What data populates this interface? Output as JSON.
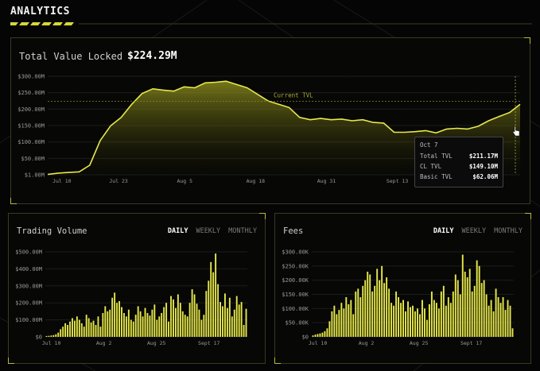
{
  "header": {
    "title": "ANALYTICS"
  },
  "colors": {
    "accent": "#e6e84a",
    "accent_dim": "#8a8b25",
    "panel_border": "#3a3a22",
    "bg": "#050505"
  },
  "icons": {
    "cursor": "hand-pointer-icon"
  },
  "tvl": {
    "label": "Total Value Locked",
    "value": "$224.29M",
    "reference_label": "Current TVL",
    "tooltip": {
      "date": "Oct 7",
      "rows": [
        {
          "label": "Total TVL",
          "value": "$211.17M"
        },
        {
          "label": "CL TVL",
          "value": "$149.10M"
        },
        {
          "label": "Basic TVL",
          "value": "$62.06M"
        }
      ]
    }
  },
  "volume": {
    "title": "Trading Volume",
    "tabs": [
      "DAILY",
      "WEEKLY",
      "MONTHLY"
    ],
    "active_tab": "DAILY"
  },
  "fees": {
    "title": "Fees",
    "tabs": [
      "DAILY",
      "WEEKLY",
      "MONTHLY"
    ],
    "active_tab": "DAILY"
  },
  "chart_data": [
    {
      "type": "area",
      "y_ticks": [
        "$300.00M",
        "$250.00M",
        "$200.00M",
        "$150.00M",
        "$100.00M",
        "$50.00M",
        "$1.00M"
      ],
      "ylim": [
        1,
        300
      ],
      "x_ticks": [
        "Jul 10",
        "Jul 23",
        "Aug 5",
        "Aug 18",
        "Aug 31",
        "Sept 13"
      ],
      "reference_value": 224.29,
      "x": [
        0,
        2,
        4,
        6,
        8,
        10,
        12,
        14,
        16,
        18,
        20,
        22,
        24,
        26,
        28,
        30,
        32,
        34,
        36,
        38,
        40,
        42,
        44,
        46,
        48,
        50,
        52,
        54,
        56,
        58,
        60,
        62,
        64,
        66,
        68,
        70,
        72,
        74,
        76,
        78,
        80,
        82,
        84,
        86,
        88,
        90
      ],
      "values": [
        2,
        6,
        8,
        10,
        30,
        105,
        150,
        175,
        215,
        248,
        262,
        258,
        255,
        268,
        265,
        280,
        282,
        285,
        275,
        265,
        245,
        225,
        215,
        205,
        175,
        168,
        172,
        168,
        170,
        165,
        168,
        160,
        158,
        130,
        130,
        132,
        135,
        128,
        140,
        142,
        140,
        148,
        165,
        178,
        190,
        215
      ],
      "grid": true
    },
    {
      "type": "bar",
      "y_ticks": [
        "$500.00M",
        "$400.00M",
        "$300.00M",
        "$200.00M",
        "$100.00M",
        "$0"
      ],
      "ylim": [
        0,
        500
      ],
      "x_ticks": [
        "Jul 10",
        "Aug 2",
        "Aug 25",
        "Sept 17"
      ],
      "values": [
        5,
        6,
        8,
        10,
        15,
        25,
        45,
        60,
        80,
        70,
        90,
        110,
        95,
        120,
        100,
        80,
        60,
        130,
        110,
        85,
        95,
        70,
        120,
        60,
        140,
        180,
        150,
        160,
        230,
        260,
        200,
        210,
        175,
        140,
        120,
        160,
        100,
        90,
        130,
        180,
        150,
        120,
        170,
        140,
        125,
        160,
        190,
        100,
        120,
        140,
        175,
        200,
        90,
        240,
        220,
        170,
        250,
        200,
        150,
        130,
        120,
        200,
        280,
        250,
        195,
        160,
        100,
        130,
        270,
        330,
        440,
        380,
        490,
        310,
        205,
        180,
        255,
        170,
        230,
        120,
        160,
        240,
        190,
        205,
        70,
        165
      ],
      "grid": true
    },
    {
      "type": "bar",
      "y_ticks": [
        "$300.00K",
        "$250.00K",
        "$200.00K",
        "$150.00K",
        "$100.00K",
        "$50.00K",
        "$0"
      ],
      "ylim": [
        0,
        300
      ],
      "x_ticks": [
        "Jul 10",
        "Aug 2",
        "Aug 25",
        "Sept 17"
      ],
      "values": [
        5,
        8,
        10,
        12,
        15,
        20,
        30,
        55,
        90,
        110,
        80,
        95,
        120,
        100,
        140,
        115,
        130,
        80,
        160,
        170,
        140,
        180,
        200,
        230,
        220,
        160,
        180,
        240,
        200,
        250,
        190,
        210,
        170,
        120,
        110,
        160,
        140,
        120,
        130,
        90,
        125,
        105,
        110,
        90,
        100,
        80,
        130,
        100,
        60,
        115,
        160,
        130,
        120,
        100,
        160,
        180,
        110,
        140,
        120,
        160,
        220,
        200,
        150,
        290,
        230,
        210,
        240,
        160,
        180,
        270,
        250,
        190,
        200,
        150,
        110,
        130,
        90,
        170,
        140,
        120,
        140,
        95,
        130,
        110,
        30
      ],
      "grid": true
    }
  ]
}
